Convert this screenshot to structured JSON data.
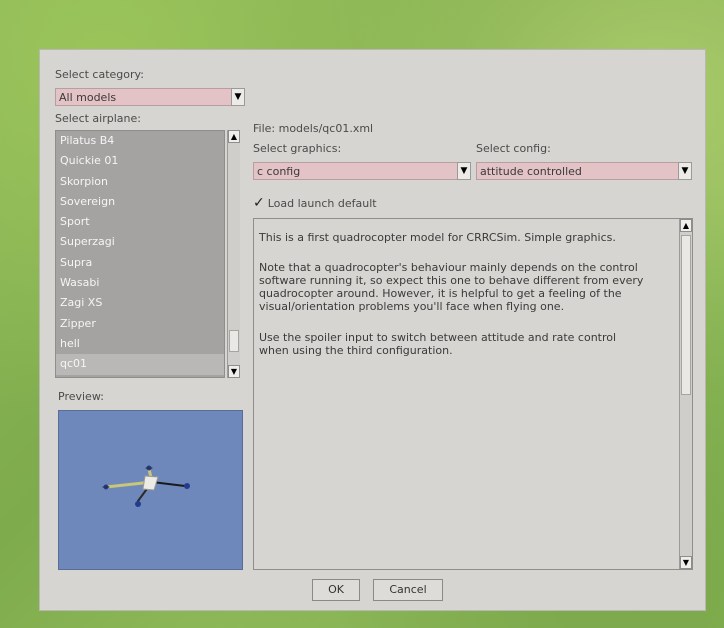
{
  "category": {
    "label": "Select category:",
    "value": "All models"
  },
  "airplane": {
    "label": "Select airplane:",
    "items": [
      "Pilatus B4",
      "Quickie 01",
      "Skorpion",
      "Sovereign",
      "Sport",
      "Superzagi",
      "Supra",
      "Wasabi",
      "Zagi XS",
      "Zipper",
      "hell",
      "qc01"
    ],
    "selected_index": 11
  },
  "preview": {
    "label": "Preview:"
  },
  "file": {
    "label": "File: models/qc01.xml"
  },
  "graphics": {
    "label": "Select graphics:",
    "value": "c config"
  },
  "config": {
    "label": "Select config:",
    "value": "attitude controlled"
  },
  "launch_default": {
    "label": "Load launch default",
    "checked": true
  },
  "description": {
    "p1": "This is a first quadrocopter model for CRRCSim. Simple graphics.",
    "p2": "Note that a quadrocopter's behaviour mainly depends on the control software running it, so expect this one to behave different from every quadrocopter around. However, it is helpful to get a feeling of the visual/orientation problems you'll face when flying one.",
    "p3": "Use the spoiler input to switch between attitude and rate control\nwhen using the third configuration."
  },
  "buttons": {
    "ok": "OK",
    "cancel": "Cancel"
  },
  "icons": {
    "dropdown": "chevron-down-icon",
    "checkmark": "checkmark-icon"
  }
}
